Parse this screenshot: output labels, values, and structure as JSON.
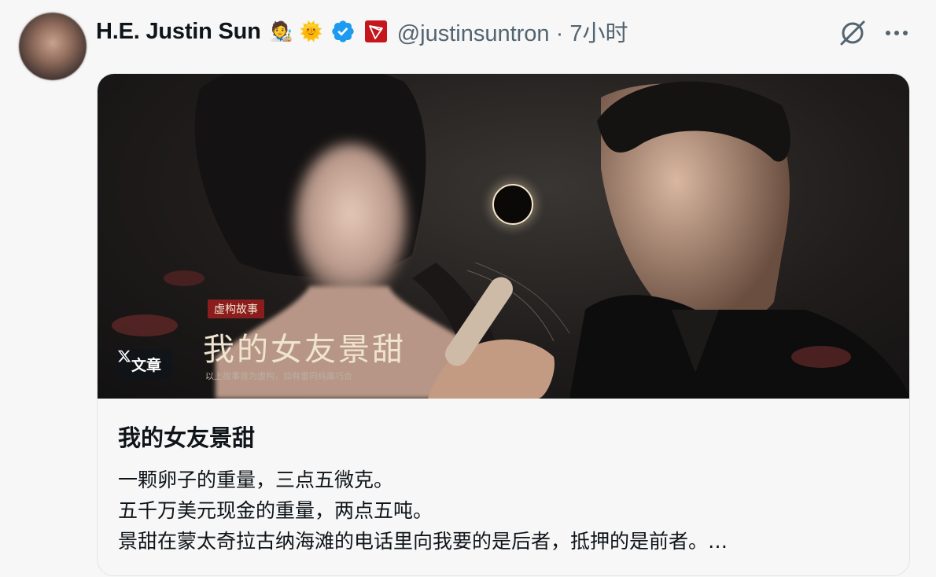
{
  "tweet": {
    "author_name": "H.E. Justin Sun",
    "handle_time": "@justinsuntron · 7小时",
    "emoji_1": "🧑‍🎨",
    "emoji_2": "🌞",
    "verified_color": "#1d9bf0",
    "org_badge_color": "#c4161c"
  },
  "icons": [
    "avatar",
    "verified-badge-icon",
    "tron-badge-icon",
    "grok-icon",
    "more-icon",
    "x-logo-icon"
  ],
  "article": {
    "badge_label": "文章",
    "poster_tag": "虚构故事",
    "poster_title": "我的女友景甜",
    "poster_note": "以上故事皆为虚构，如有雷同纯属巧合",
    "title": "我的女友景甜",
    "lines": [
      "一颗卵子的重量，三点五微克。",
      "五千万美元现金的重量，两点五吨。",
      "景甜在蒙太奇拉古纳海滩的电话里向我要的是后者，抵押的是前者。…"
    ]
  }
}
